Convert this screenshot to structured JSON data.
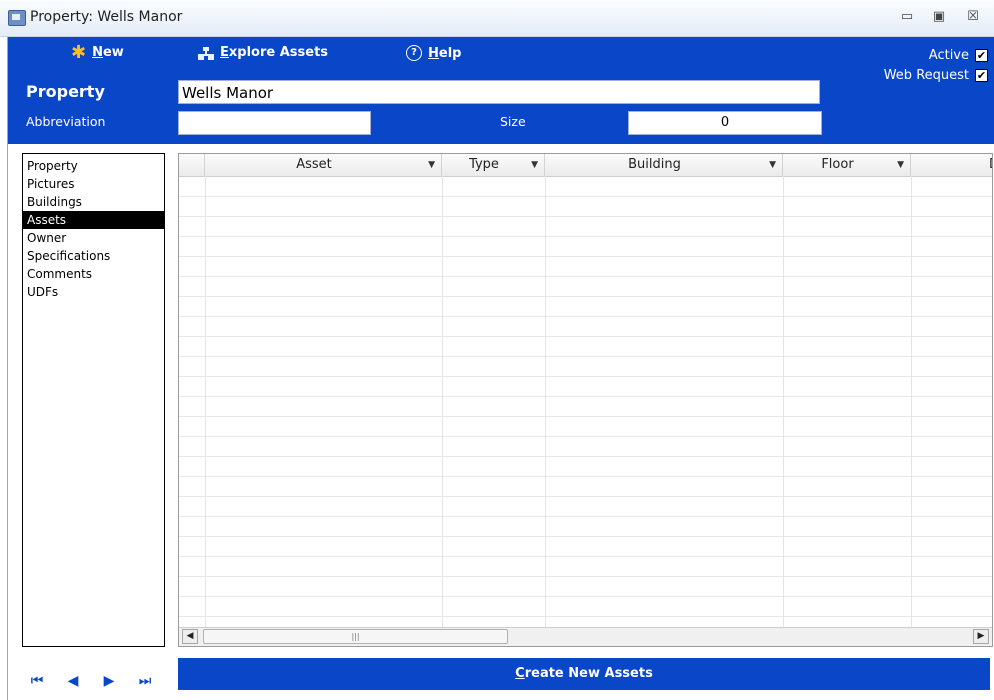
{
  "window": {
    "title": "Property: Wells Manor",
    "minimize": "▭",
    "restore": "▣",
    "close": "☒"
  },
  "toolbar": {
    "new_key": "N",
    "new_rest": "ew",
    "explore_key": "E",
    "explore_rest": "xplore Assets",
    "help_key": "H",
    "help_rest": "elp",
    "help_icon": "?"
  },
  "flags": {
    "active_label": "Active",
    "active_checked": true,
    "web_request_label": "Web Request",
    "web_request_checked": true,
    "check_mark": "✔"
  },
  "form": {
    "property_label": "Property",
    "property_value": "Wells Manor",
    "abbreviation_label": "Abbreviation",
    "abbreviation_value": "",
    "size_label": "Size",
    "size_value": "0"
  },
  "nav": {
    "items": [
      {
        "label": "Property"
      },
      {
        "label": "Pictures"
      },
      {
        "label": "Buildings"
      },
      {
        "label": "Assets",
        "selected": true
      },
      {
        "label": "Owner"
      },
      {
        "label": "Specifications"
      },
      {
        "label": "Comments"
      },
      {
        "label": "UDFs"
      }
    ]
  },
  "grid": {
    "columns": [
      {
        "label": "Asset"
      },
      {
        "label": "Type"
      },
      {
        "label": "Building"
      },
      {
        "label": "Floor"
      },
      {
        "label": "D"
      }
    ],
    "rows": []
  },
  "pager": {
    "first": "⏮",
    "prev": "◀",
    "next": "▶",
    "last": "⏭"
  },
  "create_button": {
    "key": "C",
    "rest": "reate New Assets"
  },
  "colors": {
    "brand_blue": "#0a46c8",
    "star": "#ffc01e"
  }
}
